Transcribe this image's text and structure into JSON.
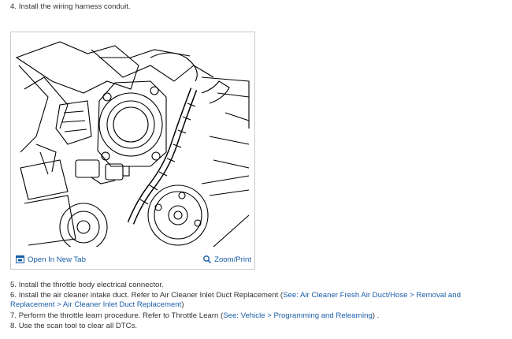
{
  "steps": [
    {
      "num": "4.",
      "text": "Install the wiring harness conduit."
    },
    {
      "num": "5.",
      "text": "Install the throttle body electrical connector."
    },
    {
      "num": "6.",
      "text": "Install the air cleaner intake duct. Refer to Air Cleaner Inlet Duct Replacement (",
      "link": "See: Air Cleaner Fresh Air Duct/Hose > Removal and Replacement > Air Cleaner Inlet Duct Replacement",
      "after": ")"
    },
    {
      "num": "7.",
      "text": "Perform the throttle learn procedure. Refer to Throttle Learn (",
      "link": "See: Vehicle > Programming and Relearning",
      "after": ") ."
    },
    {
      "num": "8.",
      "text": "Use the scan tool to clear all DTCs."
    }
  ],
  "figure": {
    "open_new_tab_label": "Open In New Tab",
    "zoom_print_label": "Zoom/Print",
    "open_icon": "open-in-new-tab-icon",
    "zoom_icon": "zoom-icon"
  },
  "colors": {
    "link": "#1a5ea8",
    "text": "#333333",
    "border": "#c9c9c9"
  }
}
